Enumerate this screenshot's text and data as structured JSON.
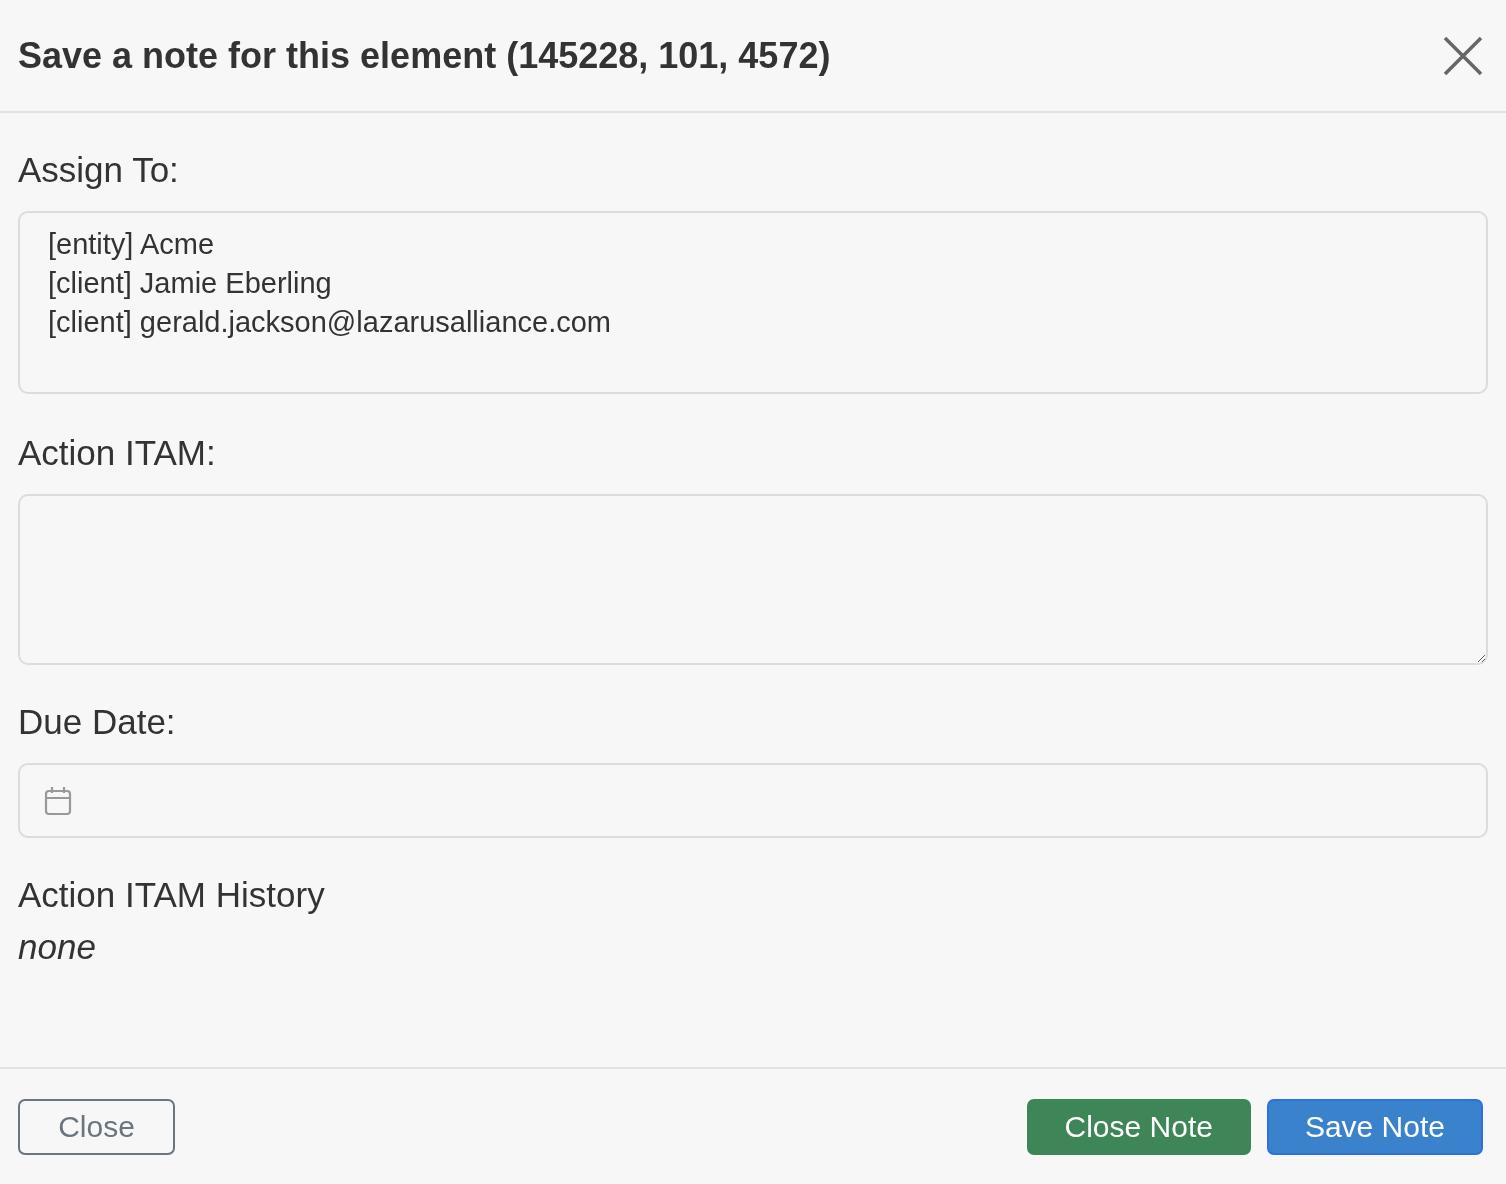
{
  "dialog": {
    "title": "Save a note for this element (145228, 101, 4572)"
  },
  "assign_to": {
    "label": "Assign To:",
    "entries": [
      "[entity] Acme",
      "[client] Jamie Eberling",
      "[client] gerald.jackson@lazarusalliance.com"
    ]
  },
  "action_itam": {
    "label": "Action ITAM:"
  },
  "due_date": {
    "label": "Due Date:"
  },
  "history": {
    "title": "Action ITAM History",
    "empty_text": "none"
  },
  "buttons": [
    {
      "label": "Close",
      "kind": "outline"
    },
    {
      "label": "Close Note",
      "kind": "success"
    },
    {
      "label": "Save Note",
      "kind": "primary"
    }
  ]
}
